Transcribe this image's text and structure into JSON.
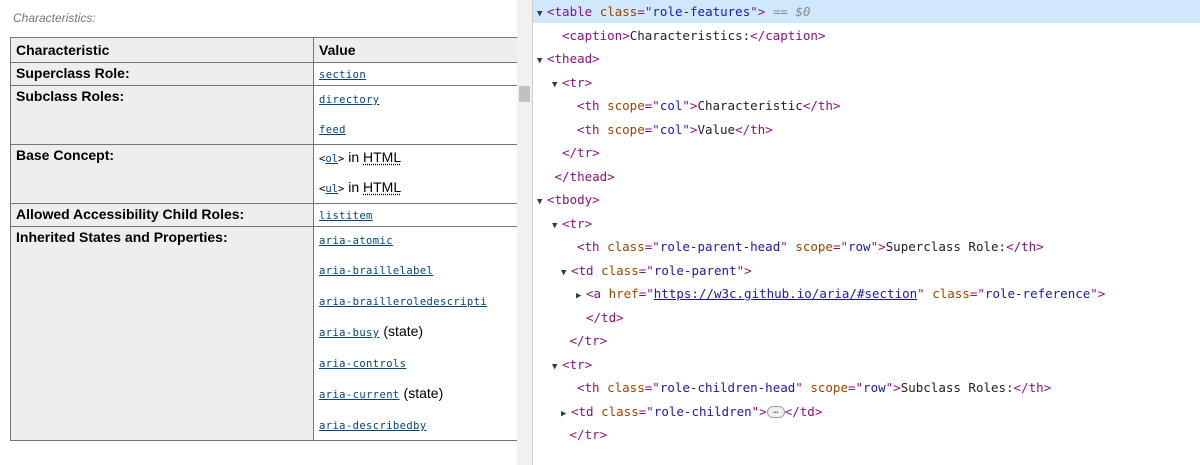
{
  "page": {
    "caption": "Characteristics:",
    "columns": [
      "Characteristic",
      "Value"
    ],
    "rows": {
      "superclass": {
        "label": "Superclass Role:",
        "links": [
          "section"
        ]
      },
      "subclass": {
        "label": "Subclass Roles:",
        "links": [
          "directory",
          "feed"
        ]
      },
      "base": {
        "label": "Base Concept:",
        "items": [
          {
            "tag_open": "<",
            "tag": "ol",
            "tag_close": ">",
            "in": " in ",
            "html": "HTML"
          },
          {
            "tag_open": "<",
            "tag": "ul",
            "tag_close": ">",
            "in": " in ",
            "html": "HTML"
          }
        ]
      },
      "allowed_children": {
        "label": "Allowed Accessibility Child Roles:",
        "links": [
          "listitem"
        ]
      },
      "inherited": {
        "label": "Inherited States and Properties:",
        "items": [
          {
            "name": "aria-atomic",
            "suffix": ""
          },
          {
            "name": "aria-braillelabel",
            "suffix": ""
          },
          {
            "name": "aria-brailleroledescripti",
            "suffix": ""
          },
          {
            "name": "aria-busy",
            "suffix": " (state)"
          },
          {
            "name": "aria-controls",
            "suffix": ""
          },
          {
            "name": "aria-current",
            "suffix": " (state)"
          },
          {
            "name": "aria-describedby",
            "suffix": ""
          }
        ]
      }
    }
  },
  "devtools": {
    "selected_marker": " == $0",
    "lines": [
      {
        "indent": 0,
        "tri": "▼",
        "parts": [
          [
            "t",
            "<table "
          ],
          [
            "an",
            "class"
          ],
          [
            "t",
            "=\""
          ],
          [
            "av",
            "role-features"
          ],
          [
            "t",
            "\">"
          ]
        ],
        "selected": true
      },
      {
        "indent": 1,
        "tri": "",
        "parts": [
          [
            "t",
            "<caption>"
          ],
          [
            "tx",
            "Characteristics:"
          ],
          [
            "t",
            "</caption>"
          ]
        ]
      },
      {
        "indent": 0,
        "tri": "▼",
        "parts": [
          [
            "t",
            "<thead>"
          ]
        ]
      },
      {
        "indent": 1,
        "tri": "▼",
        "parts": [
          [
            "t",
            "<tr>"
          ]
        ]
      },
      {
        "indent": 2,
        "tri": "",
        "parts": [
          [
            "t",
            "<th "
          ],
          [
            "an",
            "scope"
          ],
          [
            "t",
            "=\""
          ],
          [
            "av",
            "col"
          ],
          [
            "t",
            "\">"
          ],
          [
            "tx",
            "Characteristic"
          ],
          [
            "t",
            "</th>"
          ]
        ]
      },
      {
        "indent": 2,
        "tri": "",
        "parts": [
          [
            "t",
            "<th "
          ],
          [
            "an",
            "scope"
          ],
          [
            "t",
            "=\""
          ],
          [
            "av",
            "col"
          ],
          [
            "t",
            "\">"
          ],
          [
            "tx",
            "Value"
          ],
          [
            "t",
            "</th>"
          ]
        ]
      },
      {
        "indent": 1,
        "tri": "",
        "parts": [
          [
            "t",
            "</tr>"
          ]
        ]
      },
      {
        "indent": 0.5,
        "tri": "",
        "parts": [
          [
            "t",
            "</thead>"
          ]
        ]
      },
      {
        "indent": 0,
        "tri": "▼",
        "parts": [
          [
            "t",
            "<tbody>"
          ]
        ]
      },
      {
        "indent": 1,
        "tri": "▼",
        "parts": [
          [
            "t",
            "<tr>"
          ]
        ]
      },
      {
        "indent": 2,
        "tri": "",
        "parts": [
          [
            "t",
            "<th "
          ],
          [
            "an",
            "class"
          ],
          [
            "t",
            "=\""
          ],
          [
            "av",
            "role-parent-head"
          ],
          [
            "t",
            "\" "
          ],
          [
            "an",
            "scope"
          ],
          [
            "t",
            "=\""
          ],
          [
            "av",
            "row"
          ],
          [
            "t",
            "\">"
          ],
          [
            "tx",
            "Superclass Role:"
          ],
          [
            "t",
            "</th>"
          ]
        ]
      },
      {
        "indent": 1.6,
        "tri": "▼",
        "parts": [
          [
            "t",
            "<td "
          ],
          [
            "an",
            "class"
          ],
          [
            "t",
            "=\""
          ],
          [
            "av",
            "role-parent"
          ],
          [
            "t",
            "\">"
          ]
        ]
      },
      {
        "indent": 2.6,
        "tri": "▶",
        "parts": [
          [
            "t",
            "<a "
          ],
          [
            "an",
            "href"
          ],
          [
            "t",
            "=\""
          ],
          [
            "hl",
            "https://w3c.github.io/aria/#section"
          ],
          [
            "t",
            "\" "
          ],
          [
            "an",
            "class"
          ],
          [
            "t",
            "=\""
          ],
          [
            "av",
            "role-reference"
          ],
          [
            "t",
            "\">"
          ]
        ]
      },
      {
        "indent": 2.6,
        "tri": "",
        "parts": [
          [
            "t",
            "</td>"
          ]
        ]
      },
      {
        "indent": 1.5,
        "tri": "",
        "parts": [
          [
            "t",
            "</tr>"
          ]
        ]
      },
      {
        "indent": 1,
        "tri": "▼",
        "parts": [
          [
            "t",
            "<tr>"
          ]
        ]
      },
      {
        "indent": 2,
        "tri": "",
        "parts": [
          [
            "t",
            "<th "
          ],
          [
            "an",
            "class"
          ],
          [
            "t",
            "=\""
          ],
          [
            "av",
            "role-children-head"
          ],
          [
            "t",
            "\" "
          ],
          [
            "an",
            "scope"
          ],
          [
            "t",
            "=\""
          ],
          [
            "av",
            "row"
          ],
          [
            "t",
            "\">"
          ],
          [
            "tx",
            "Subclass Roles:"
          ],
          [
            "t",
            "</th>"
          ]
        ]
      },
      {
        "indent": 1.6,
        "tri": "▶",
        "parts": [
          [
            "t",
            "<td "
          ],
          [
            "an",
            "class"
          ],
          [
            "t",
            "=\""
          ],
          [
            "av",
            "role-children"
          ],
          [
            "t",
            "\">"
          ],
          [
            "ellipsis",
            "…"
          ],
          [
            "t",
            "</td>"
          ]
        ]
      },
      {
        "indent": 1.5,
        "tri": "",
        "parts": [
          [
            "t",
            "</tr>"
          ]
        ]
      }
    ]
  },
  "colors": {
    "link": "#034575",
    "tag": "#881280",
    "attr_name": "#994500",
    "attr_value": "#1a1aa6",
    "selected_row": "#cfe8fc"
  }
}
